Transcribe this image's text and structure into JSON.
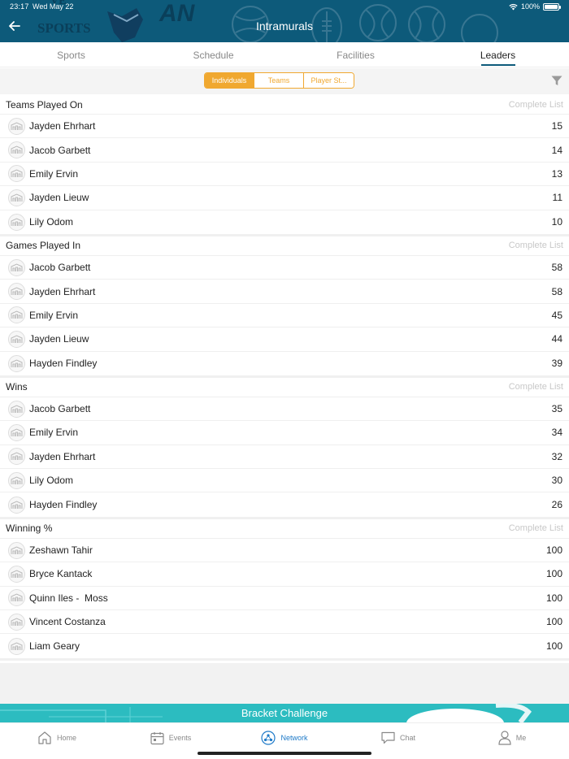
{
  "status": {
    "time": "23:17",
    "date": "Wed May 22",
    "battery": "100%"
  },
  "header": {
    "title": "Intramurals",
    "deco_text_1": "SPORTS",
    "deco_text_2": "AN"
  },
  "tabs": [
    {
      "label": "Sports",
      "active": false
    },
    {
      "label": "Schedule",
      "active": false
    },
    {
      "label": "Facilities",
      "active": false
    },
    {
      "label": "Leaders",
      "active": true
    }
  ],
  "segments": [
    {
      "label": "Individuals",
      "active": true
    },
    {
      "label": "Teams",
      "active": false
    },
    {
      "label": "Player St...",
      "active": false
    }
  ],
  "sections": [
    {
      "title": "Teams Played On",
      "link": "Complete List",
      "rows": [
        {
          "name": "Jayden Ehrhart",
          "value": "15"
        },
        {
          "name": "Jacob Garbett",
          "value": "14"
        },
        {
          "name": "Emily Ervin",
          "value": "13"
        },
        {
          "name": "Jayden Lieuw",
          "value": "11"
        },
        {
          "name": "Lily Odom",
          "value": "10"
        }
      ]
    },
    {
      "title": "Games Played In",
      "link": "Complete List",
      "rows": [
        {
          "name": "Jacob Garbett",
          "value": "58"
        },
        {
          "name": "Jayden Ehrhart",
          "value": "58"
        },
        {
          "name": "Emily Ervin",
          "value": "45"
        },
        {
          "name": "Jayden Lieuw",
          "value": "44"
        },
        {
          "name": "Hayden Findley",
          "value": "39"
        }
      ]
    },
    {
      "title": "Wins",
      "link": "Complete List",
      "rows": [
        {
          "name": "Jacob Garbett",
          "value": "35"
        },
        {
          "name": "Emily Ervin",
          "value": "34"
        },
        {
          "name": "Jayden Ehrhart",
          "value": "32"
        },
        {
          "name": "Lily Odom",
          "value": "30"
        },
        {
          "name": "Hayden Findley",
          "value": "26"
        }
      ]
    },
    {
      "title": "Winning %",
      "link": "Complete List",
      "rows": [
        {
          "name": "Zeshawn Tahir",
          "value": "100"
        },
        {
          "name": "Bryce Kantack",
          "value": "100"
        },
        {
          "name": "Quinn Iles -  Moss",
          "value": "100"
        },
        {
          "name": "Vincent Costanza",
          "value": "100"
        },
        {
          "name": "Liam Geary",
          "value": "100"
        }
      ]
    }
  ],
  "banner": {
    "label": "Bracket Challenge"
  },
  "bottom_nav": [
    {
      "label": "Home",
      "icon": "home-icon",
      "active": false
    },
    {
      "label": "Events",
      "icon": "calendar-icon",
      "active": false
    },
    {
      "label": "Network",
      "icon": "network-icon",
      "active": true
    },
    {
      "label": "Chat",
      "icon": "chat-icon",
      "active": false
    },
    {
      "label": "Me",
      "icon": "person-icon",
      "active": false
    }
  ],
  "colors": {
    "header": "#0d5a7a",
    "accent": "#f0a830",
    "banner": "#2cbcc0",
    "nav_active": "#1e7ac8"
  }
}
